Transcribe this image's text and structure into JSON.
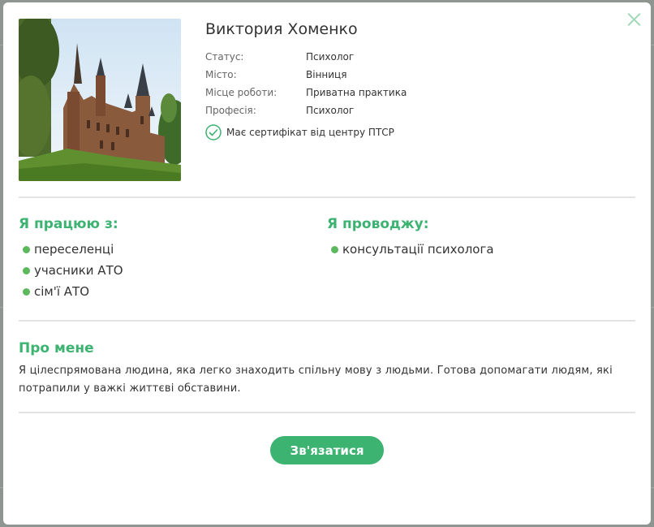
{
  "profile": {
    "name": "Виктория Хоменко",
    "photo_alt": "castle-photo",
    "info": [
      {
        "label": "Статус:",
        "value": "Психолог"
      },
      {
        "label": "Місто:",
        "value": "Вінниця"
      },
      {
        "label": "Місце роботи:",
        "value": "Приватна практика"
      },
      {
        "label": "Професія:",
        "value": "Психолог"
      }
    ],
    "certificate_text": "Має сертифікат від центру ПТСР"
  },
  "works_with": {
    "title": "Я працюю з:",
    "items": [
      "переселенці",
      "учасники АТО",
      "сім'ї АТО"
    ]
  },
  "conducts": {
    "title": "Я проводжу:",
    "items": [
      "консультації психолога"
    ]
  },
  "about": {
    "title": "Про мене",
    "text": "Я цілеспрямована людина, яка легко знаходить спільну мову з людьми. Готова допомагати людям, які потрапили у важкі життєві обставини."
  },
  "contact_button": "Зв'язатися",
  "colors": {
    "accent": "#3cb371",
    "bullet": "#5cb85c",
    "close": "#9fd8b6"
  }
}
